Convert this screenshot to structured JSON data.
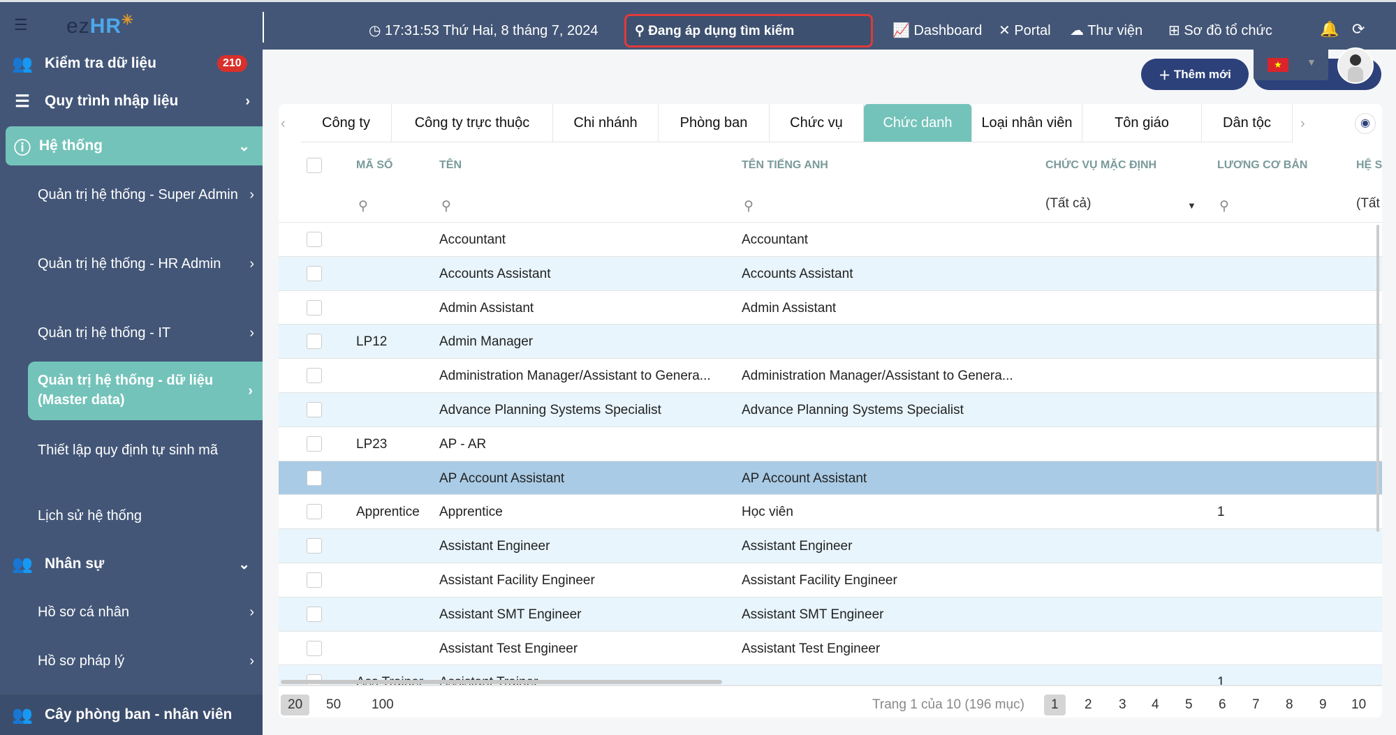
{
  "header": {
    "clock": "17:31:53 Thứ Hai, 8 tháng 7, 2024",
    "search": "Đang áp dụng tìm kiếm",
    "nav": [
      "Dashboard",
      "Portal",
      "Thư viện",
      "Sơ đồ tổ chức"
    ],
    "logo": "ezHR"
  },
  "sidebar": {
    "check": "Kiểm tra dữ liệu",
    "check_badge": "210",
    "process": "Quy trình nhập liệu",
    "system": "Hệ thống",
    "subs": [
      "Quản trị hệ thống - Super Admin",
      "Quản trị hệ thống - HR Admin",
      "Quản trị hệ thống - IT",
      "Quản trị hệ thống - dữ liệu (Master data)",
      "Thiết lập quy định tự sinh mã",
      "Lịch sử hệ thống"
    ],
    "hr": "Nhân sự",
    "hr_subs": [
      "Hồ sơ cá nhân",
      "Hồ sơ pháp lý"
    ],
    "tree": "Cây phòng ban - nhân viên"
  },
  "toolbar": {
    "add": "Thêm mới"
  },
  "tabs": [
    "Công ty",
    "Công ty trực thuộc",
    "Chi nhánh",
    "Phòng ban",
    "Chức vụ",
    "Chức danh",
    "Loại nhân viên",
    "Tôn giáo",
    "Dân tộc"
  ],
  "active_tab": "Chức danh",
  "table": {
    "headers": [
      "MÃ SỐ",
      "TÊN",
      "TÊN TIẾNG ANH",
      "CHỨC VỤ MẶC ĐỊNH",
      "LƯƠNG CƠ BẢN",
      "HỆ S"
    ],
    "filter_all": "(Tất cả)",
    "filter_all_cut": "(Tất",
    "rows": [
      [
        "",
        "Accountant",
        "Accountant",
        ""
      ],
      [
        "",
        "Accounts Assistant",
        "Accounts Assistant",
        ""
      ],
      [
        "",
        "Admin Assistant",
        "Admin Assistant",
        ""
      ],
      [
        "LP12",
        "Admin Manager",
        "",
        ""
      ],
      [
        "",
        "Administration Manager/Assistant to Genera...",
        "Administration Manager/Assistant to Genera...",
        ""
      ],
      [
        "",
        "Advance Planning Systems Specialist",
        "Advance Planning Systems Specialist",
        ""
      ],
      [
        "LP23",
        "AP - AR",
        "",
        ""
      ],
      [
        "",
        "AP Account Assistant",
        "AP Account Assistant",
        ""
      ],
      [
        "Apprentice",
        "Apprentice",
        "Học viên",
        "1"
      ],
      [
        "",
        "Assistant Engineer",
        "Assistant Engineer",
        ""
      ],
      [
        "",
        "Assistant Facility Engineer",
        "Assistant Facility Engineer",
        ""
      ],
      [
        "",
        "Assistant SMT Engineer",
        "Assistant SMT Engineer",
        ""
      ],
      [
        "",
        "Assistant Test Engineer",
        "Assistant Test Engineer",
        ""
      ],
      [
        "Ass Trainer",
        "Assistant Trainer",
        "",
        "1"
      ]
    ],
    "selected_row": 7
  },
  "pagination": {
    "sizes": [
      "20",
      "50",
      "100"
    ],
    "info": "Trang 1 của 10 (196 mục)",
    "pages": [
      "1",
      "2",
      "3",
      "4",
      "5",
      "6",
      "7",
      "8",
      "9",
      "10"
    ],
    "current": "1"
  },
  "colors": {
    "header": "#435677",
    "accent": "#74c3ba",
    "selected": "#a9cbe6",
    "alt": "#e8f5fd",
    "badge": "#d8302b",
    "button": "#2c417a"
  }
}
